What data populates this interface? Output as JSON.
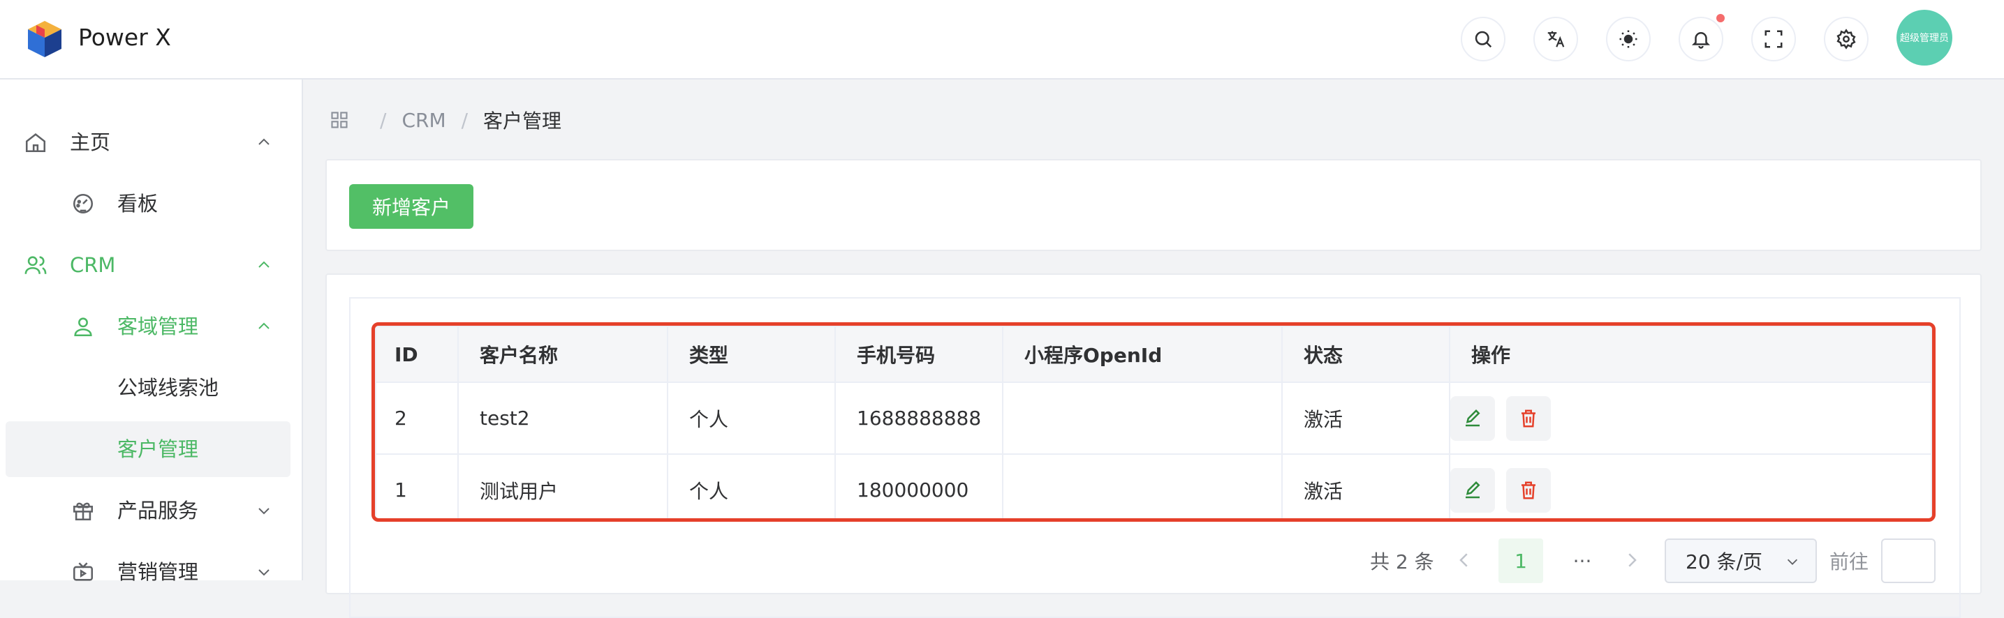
{
  "app": {
    "title": "Power X"
  },
  "header": {
    "icons": [
      "search-icon",
      "translate-icon",
      "theme-icon",
      "bell-icon",
      "fullscreen-icon",
      "settings-icon"
    ],
    "avatar_text": "超级管理员",
    "accent": "#4cb865",
    "notification_dot_color": "#f56c6c"
  },
  "sidebar": {
    "items": [
      {
        "label": "主页",
        "icon": "home-icon",
        "expanded": true
      },
      {
        "label": "看板",
        "icon": "dashboard-icon"
      },
      {
        "label": "CRM",
        "icon": "users-icon",
        "expanded": true,
        "highlight": true
      },
      {
        "label": "客域管理",
        "icon": "user-icon",
        "expanded": true,
        "highlight": true
      },
      {
        "label": "公域线索池"
      },
      {
        "label": "客户管理",
        "active": true
      },
      {
        "label": "产品服务",
        "icon": "gift-icon",
        "expanded": false
      },
      {
        "label": "营销管理",
        "icon": "tv-icon",
        "expanded": false
      }
    ]
  },
  "breadcrumb": {
    "items": [
      "CRM",
      "客户管理"
    ]
  },
  "toolbar": {
    "add_label": "新增客户"
  },
  "table": {
    "columns": [
      "ID",
      "客户名称",
      "类型",
      "手机号码",
      "小程序OpenId",
      "状态",
      "操作"
    ],
    "rows": [
      {
        "id": "2",
        "name": "test2",
        "type": "个人",
        "phone": "1688888888",
        "openid": "",
        "status": "激活"
      },
      {
        "id": "1",
        "name": "测试用户",
        "type": "个人",
        "phone": "180000000",
        "openid": "",
        "status": "激活"
      }
    ],
    "highlight_color": "#e5402a"
  },
  "pagination": {
    "total_text": "共 2 条",
    "current_page": "1",
    "more": "···",
    "page_size": "20 条/页",
    "goto_label": "前往",
    "goto_value": ""
  }
}
